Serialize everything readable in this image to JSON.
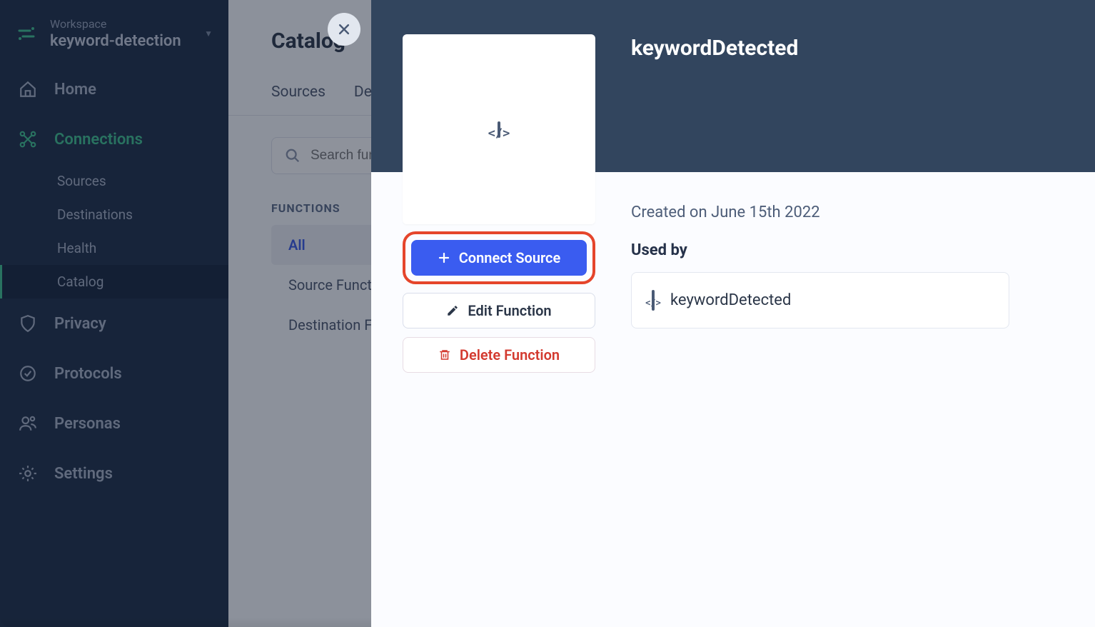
{
  "workspace": {
    "label": "Workspace",
    "name": "keyword-detection"
  },
  "nav": {
    "home": "Home",
    "connections": "Connections",
    "sub": {
      "sources": "Sources",
      "destinations": "Destinations",
      "health": "Health",
      "catalog": "Catalog"
    },
    "privacy": "Privacy",
    "protocols": "Protocols",
    "personas": "Personas",
    "settings": "Settings"
  },
  "main": {
    "title": "Catalog",
    "tabs": {
      "sources": "Sources",
      "destinations": "Destinations"
    },
    "search_placeholder": "Search functions",
    "functions_label": "FUNCTIONS",
    "filters": {
      "all": "All",
      "source": "Source Functions",
      "destination": "Destination Functions"
    }
  },
  "panel": {
    "title": "keywordDetected",
    "created": "Created on June 15th 2022",
    "usedby_label": "Used by",
    "usedby_item": "keywordDetected",
    "actions": {
      "connect": "Connect Source",
      "edit": "Edit Function",
      "delete": "Delete Function"
    }
  }
}
